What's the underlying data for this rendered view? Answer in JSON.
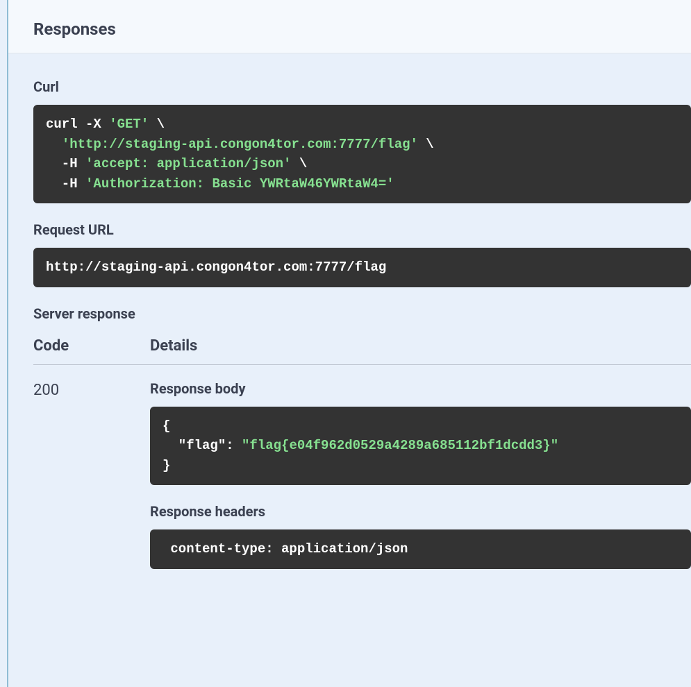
{
  "section_title": "Responses",
  "curl": {
    "heading": "Curl",
    "cmd_line1_a": "curl -X ",
    "cmd_line1_b": "'GET'",
    "cmd_line1_c": " \\",
    "cmd_line2_a": "  ",
    "cmd_line2_b": "'http://staging-api.congon4tor.com:7777/flag'",
    "cmd_line2_c": " \\",
    "cmd_line3_a": "  -H ",
    "cmd_line3_b": "'accept: application/json'",
    "cmd_line3_c": " \\",
    "cmd_line4_a": "  -H ",
    "cmd_line4_b": "'Authorization: Basic YWRtaW46YWRtaW4='"
  },
  "request_url": {
    "heading": "Request URL",
    "value": "http://staging-api.congon4tor.com:7777/flag"
  },
  "server_response": {
    "heading": "Server response",
    "col_code": "Code",
    "col_details": "Details",
    "code": "200",
    "response_body_heading": "Response body",
    "body_line1": "{",
    "body_line2_key": "  \"flag\"",
    "body_line2_sep": ": ",
    "body_line2_val": "\"flag{e04f962d0529a4289a685112bf1dcdd3}\"",
    "body_line3": "}",
    "response_headers_heading": "Response headers",
    "headers_line": " content-type: application/json "
  }
}
